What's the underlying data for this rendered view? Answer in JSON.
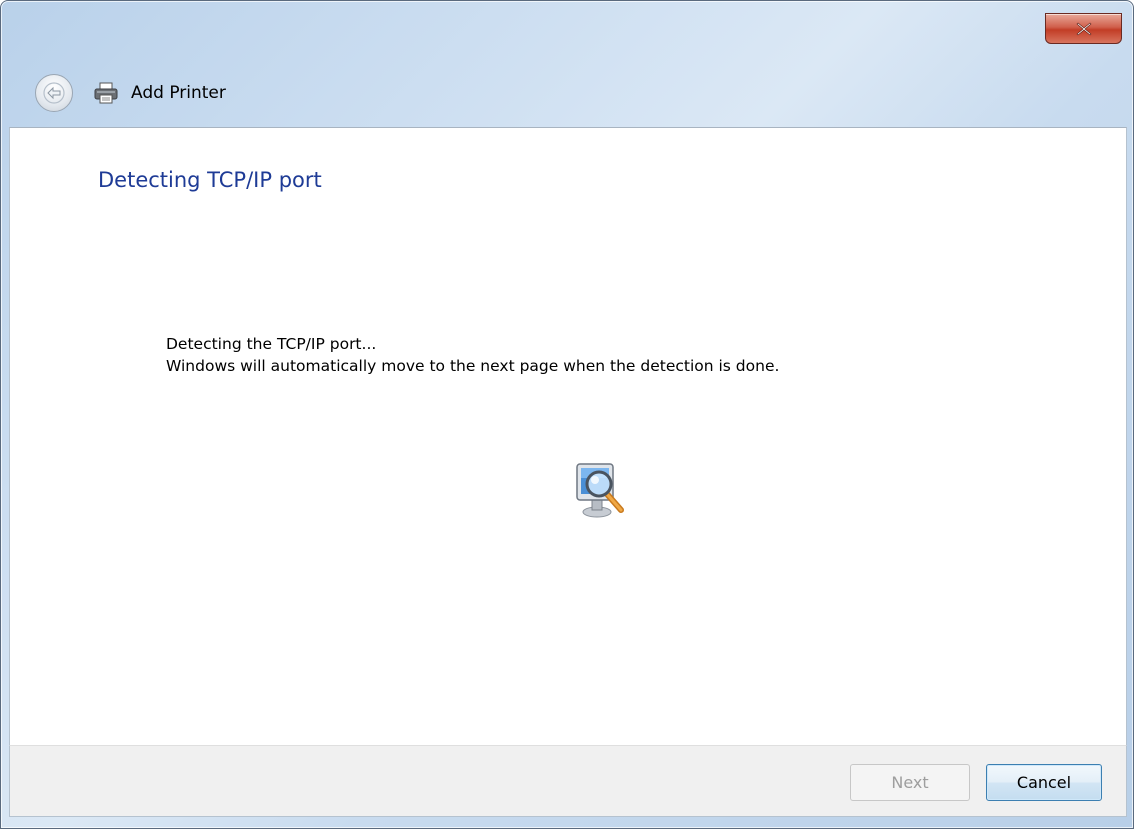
{
  "window": {
    "title": "Add Printer",
    "close_icon": "close-icon"
  },
  "nav": {
    "back_icon": "back-arrow-icon",
    "title_icon": "printer-icon"
  },
  "main": {
    "heading": "Detecting TCP/IP port",
    "message_line1": "Detecting the TCP/IP port...",
    "message_line2": "Windows will automatically move to the next page when the detection is done.",
    "status_icon": "computer-magnifier-icon"
  },
  "footer": {
    "next_label": "Next",
    "next_enabled": false,
    "cancel_label": "Cancel"
  },
  "colors": {
    "heading": "#1e3b96",
    "close_button": "#c23d26",
    "disabled_text": "#9e9e9e"
  }
}
